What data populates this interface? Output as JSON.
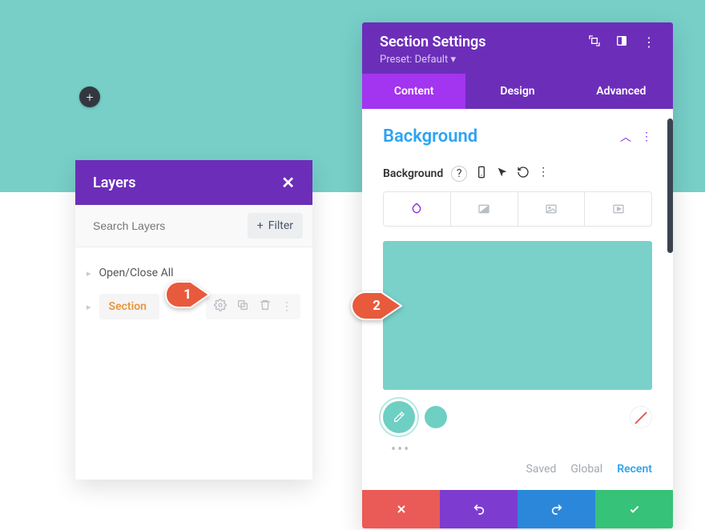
{
  "add_button_glyph": "+",
  "layers": {
    "title": "Layers",
    "search_placeholder": "Search Layers",
    "filter_label": "Filter",
    "open_close_label": "Open/Close All",
    "section_label": "Section"
  },
  "settings": {
    "title": "Section Settings",
    "preset_label": "Preset: Default",
    "tabs": {
      "content": "Content",
      "design": "Design",
      "advanced": "Advanced"
    },
    "section_heading": "Background",
    "bg_label": "Background",
    "palette": {
      "saved": "Saved",
      "global": "Global",
      "recent": "Recent"
    },
    "preview_color": "#79d1ca"
  },
  "callouts": {
    "one": "1",
    "two": "2"
  }
}
